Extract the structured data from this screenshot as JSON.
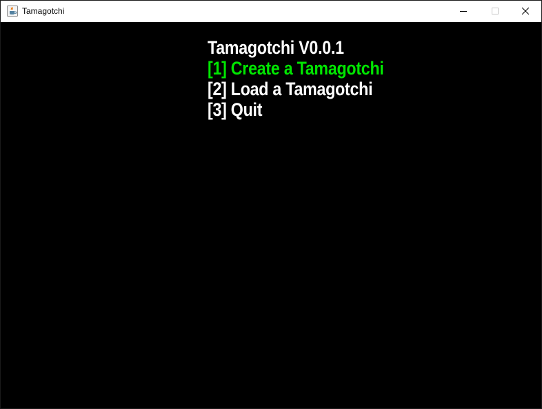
{
  "window": {
    "title": "Tamagotchi",
    "app_icon": "java-coffee-cup-icon",
    "controls": {
      "minimize_icon": "minimize-icon",
      "maximize_icon": "maximize-icon",
      "close_icon": "close-icon"
    }
  },
  "menu": {
    "title": "Tamagotchi V0.0.1",
    "options": [
      {
        "label": "[1] Create a Tamagotchi",
        "selected": true
      },
      {
        "label": "[2] Load a Tamagotchi",
        "selected": false
      },
      {
        "label": "[3] Quit",
        "selected": false
      }
    ]
  },
  "colors": {
    "background": "#000000",
    "text": "#ffffff",
    "selected": "#00e600",
    "titlebar": "#ffffff"
  }
}
